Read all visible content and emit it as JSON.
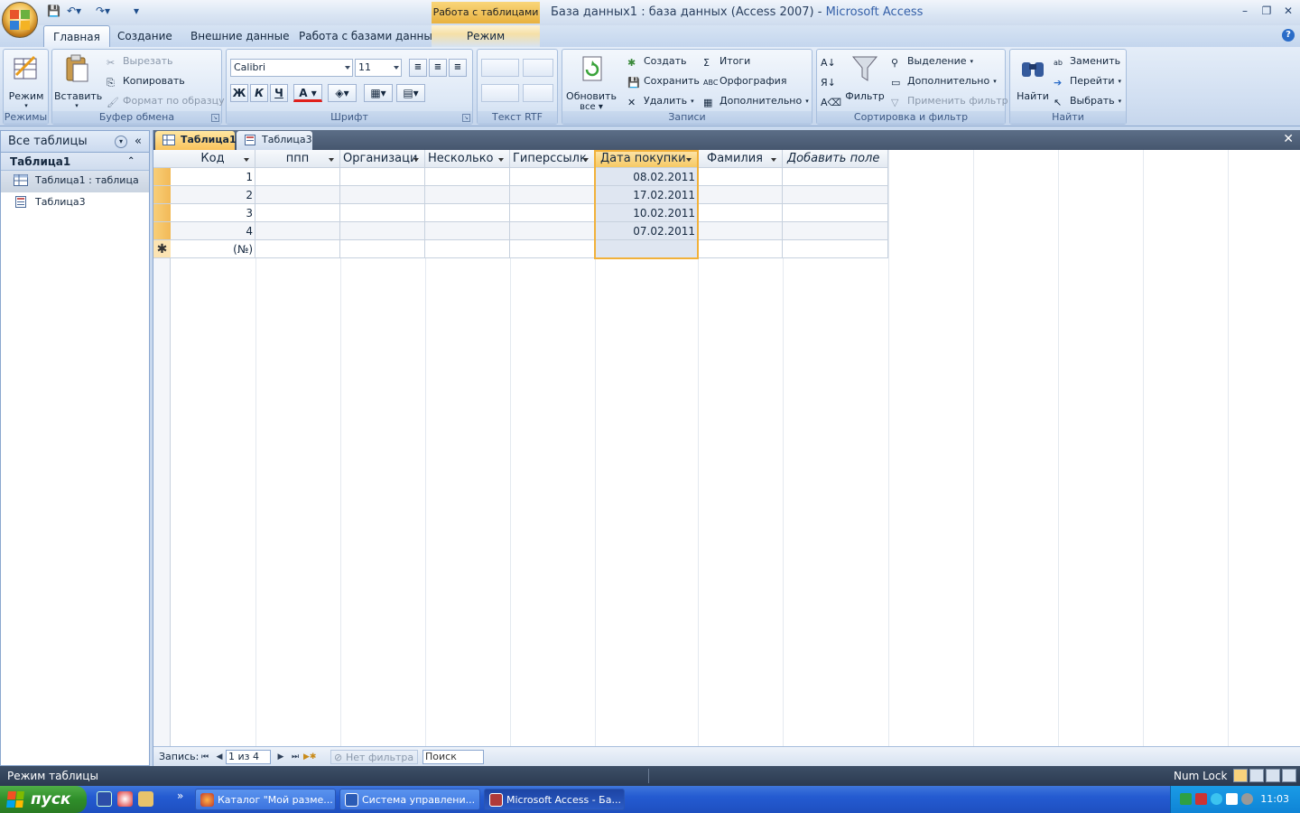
{
  "window": {
    "context_tab": "Работа с таблицами",
    "title": "База данных1 : база данных (Access 2007)",
    "title_sep": " - ",
    "app_name": "Microsoft Access"
  },
  "ribbon": {
    "tabs": [
      "Главная",
      "Создание",
      "Внешние данные",
      "Работа с базами данных",
      "Режим таблицы"
    ],
    "groups": {
      "views": {
        "name": "Режимы",
        "mode_label": "Режим"
      },
      "clipboard": {
        "name": "Буфер обмена",
        "paste": "Вставить",
        "cut": "Вырезать",
        "copy": "Копировать",
        "format_painter": "Формат по образцу"
      },
      "font": {
        "name": "Шрифт",
        "font_name": "Calibri",
        "font_size": "11",
        "bold": "Ж",
        "italic": "К",
        "underline": "Ч",
        "font_color_glyph": "A"
      },
      "rtf": {
        "name": "Текст RTF"
      },
      "records": {
        "name": "Записи",
        "refresh": "Обновить",
        "refresh2": "все",
        "new": "Создать",
        "save": "Сохранить",
        "delete": "Удалить",
        "totals": "Итоги",
        "spelling": "Орфография",
        "more": "Дополнительно"
      },
      "sort": {
        "name": "Сортировка и фильтр",
        "filter": "Фильтр",
        "selection": "Выделение",
        "advanced": "Дополнительно",
        "toggle_filter": "Применить фильтр"
      },
      "find": {
        "name": "Найти",
        "find": "Найти",
        "replace": "Заменить",
        "goto": "Перейти",
        "select": "Выбрать"
      }
    }
  },
  "nav": {
    "header": "Все таблицы",
    "group": "Таблица1",
    "items": [
      "Таблица1 : таблица",
      "Таблица3"
    ]
  },
  "doc_tabs": [
    "Таблица1",
    "Таблица3"
  ],
  "grid": {
    "columns": [
      "Код",
      "ппп",
      "Организаци",
      "Несколько",
      "Гиперссылк",
      "Дата покупки",
      "Фамилия",
      "Добавить поле"
    ],
    "rows": [
      {
        "id": "1",
        "date": "08.02.2011"
      },
      {
        "id": "2",
        "date": "17.02.2011"
      },
      {
        "id": "3",
        "date": "10.02.2011"
      },
      {
        "id": "4",
        "date": "07.02.2011"
      }
    ],
    "new_row_id": "(№)",
    "new_row_marker": "✱"
  },
  "record_nav": {
    "label": "Запись:",
    "position": "1 из 4",
    "filter": "Нет фильтра",
    "search": "Поиск"
  },
  "status": {
    "mode": "Режим таблицы",
    "numlock": "Num Lock"
  },
  "taskbar": {
    "start": "пуск",
    "tasks": [
      "Каталог \"Мой разме...",
      "Система управлени...",
      "Microsoft Access - Ба..."
    ],
    "clock": "11:03"
  },
  "colors": {
    "accent": "#f1b13a",
    "ribbon": "#d0def1",
    "taskbar": "#245bd1"
  }
}
